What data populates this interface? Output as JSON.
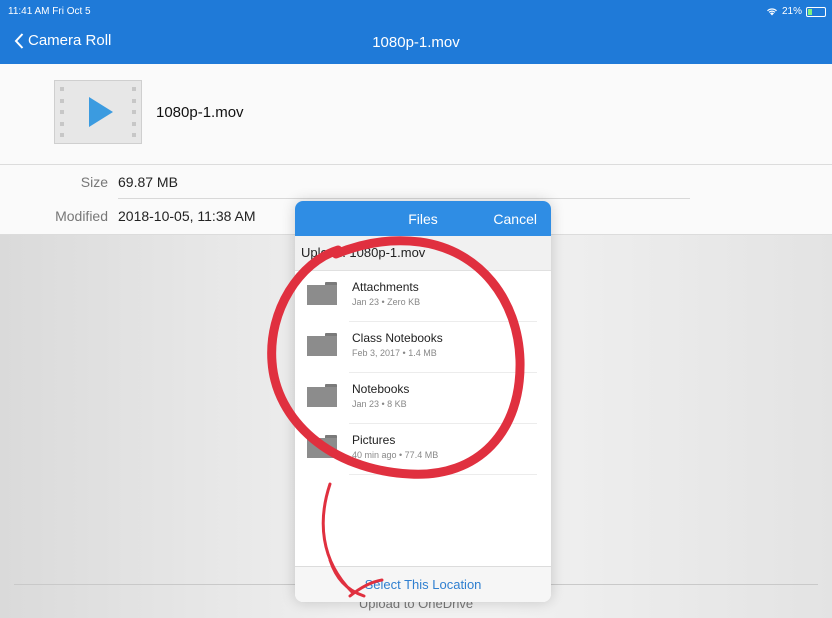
{
  "status": {
    "time": "11:41 AM  Fri Oct 5",
    "battery": "21%"
  },
  "nav": {
    "back_label": "Camera Roll",
    "title": "1080p-1.mov"
  },
  "file": {
    "name": "1080p-1.mov"
  },
  "details": {
    "size_label": "Size",
    "size_value": "69.87 MB",
    "modified_label": "Modified",
    "modified_value": "2018-10-05, 11:38 AM"
  },
  "modal": {
    "title": "Files",
    "cancel_label": "Cancel",
    "upload_text": "Upload: 1080p-1.mov",
    "folders": [
      {
        "name": "Attachments",
        "meta": "Jan 23 • Zero KB"
      },
      {
        "name": "Class Notebooks",
        "meta": "Feb 3, 2017 • 1.4 MB"
      },
      {
        "name": "Notebooks",
        "meta": "Jan 23 • 8 KB"
      },
      {
        "name": "Pictures",
        "meta": "40 min ago • 77.4 MB"
      }
    ],
    "select_label": "Select This Location"
  },
  "bottom": {
    "upload_label": "Upload to OneDrive"
  },
  "colors": {
    "header": "#1f7ad8",
    "modal_header": "#2f8de4",
    "annotation": "#e0303f"
  },
  "icons": [
    "chevron-left-icon",
    "wifi-icon",
    "battery-icon",
    "video-file-icon",
    "folder-icon"
  ]
}
